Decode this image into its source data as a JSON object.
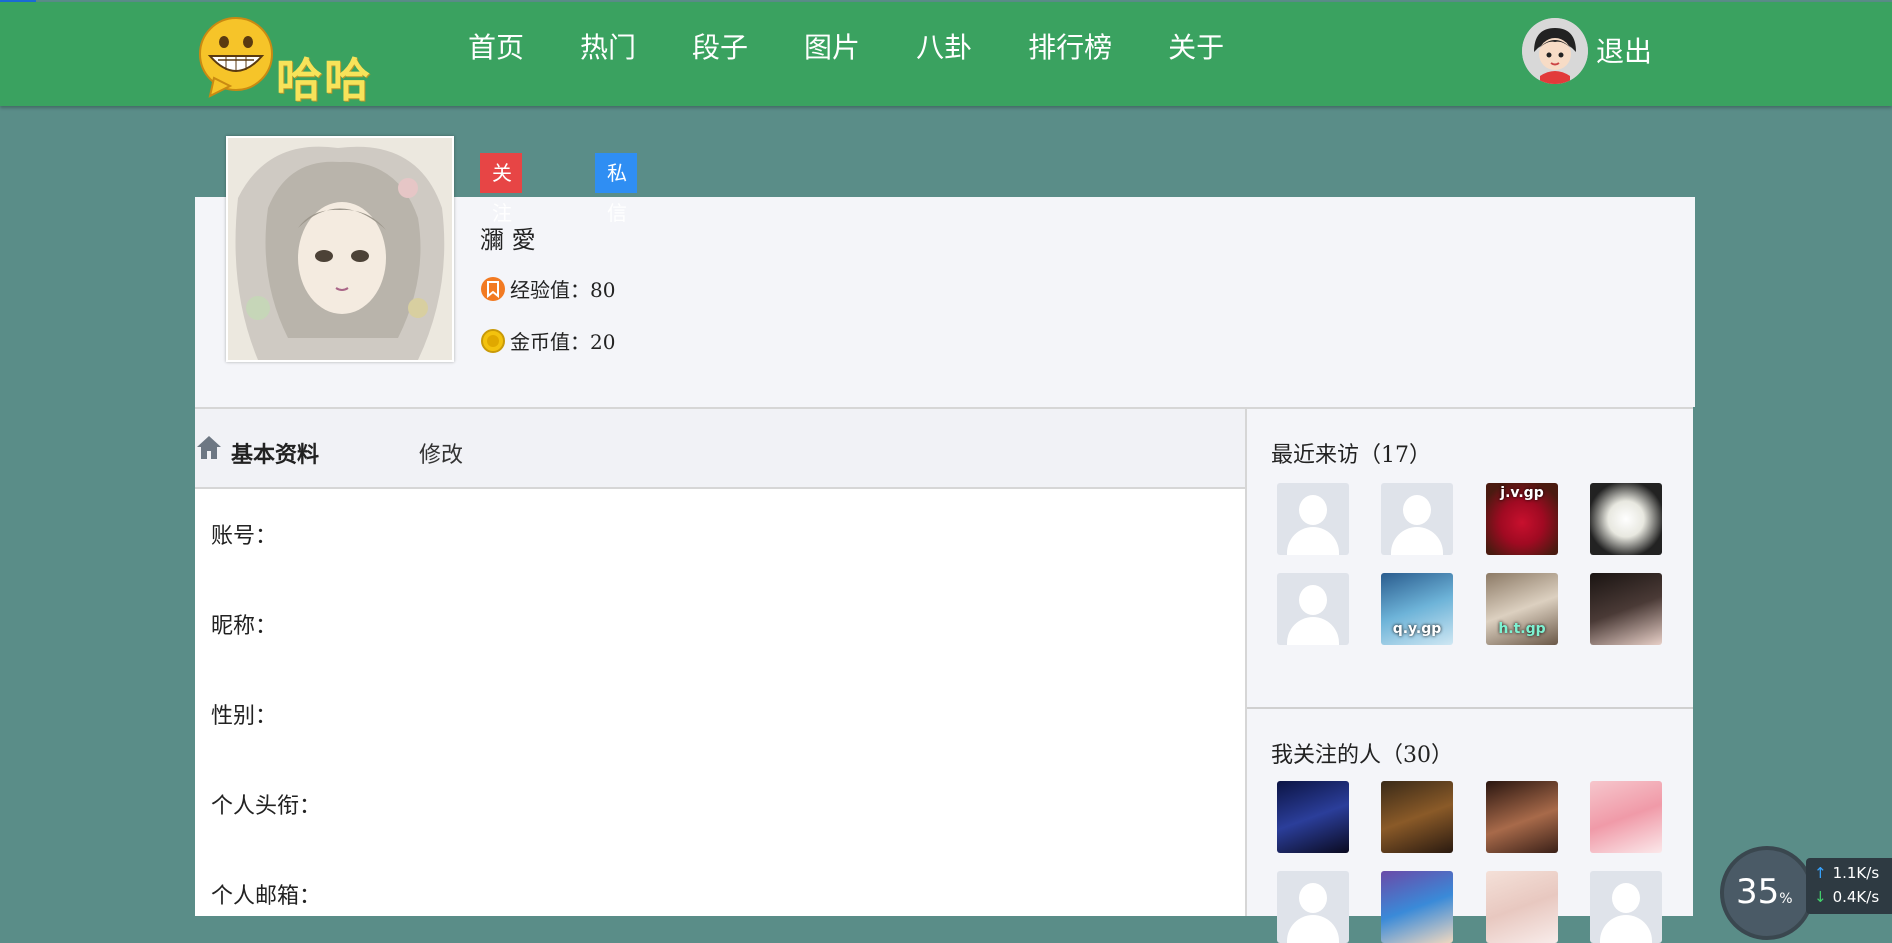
{
  "header": {
    "logo_text": "哈哈",
    "nav": [
      "首页",
      "热门",
      "段子",
      "图片",
      "八卦",
      "排行榜",
      "关于"
    ],
    "logout_label": "退出"
  },
  "profile": {
    "follow_label": "关注",
    "message_label": "私信",
    "username": "瀰 愛",
    "experience_text": "经验值：80",
    "coins_text": "金币值：20"
  },
  "tabs": {
    "basic_info": "基本资料",
    "edit": "修改"
  },
  "fields": [
    "账号：",
    "昵称：",
    "性别：",
    "个人头衔：",
    "个人邮箱："
  ],
  "sidebar": {
    "visitors_title": "最近来访（17）",
    "following_title": "我关注的人（30）",
    "visitor_watermarks": [
      "",
      "",
      "j.v.gp",
      "",
      "",
      "q.y.gp",
      "h.t.gp",
      ""
    ]
  },
  "speed_widget": {
    "percent": "35",
    "percent_unit": "%",
    "upload": "1.1K/s",
    "download": "0.4K/s"
  },
  "colors": {
    "header_bg": "#3aa260",
    "page_bg": "#5a8d88",
    "follow_button": "#e74545",
    "message_button": "#2f8ef3"
  }
}
